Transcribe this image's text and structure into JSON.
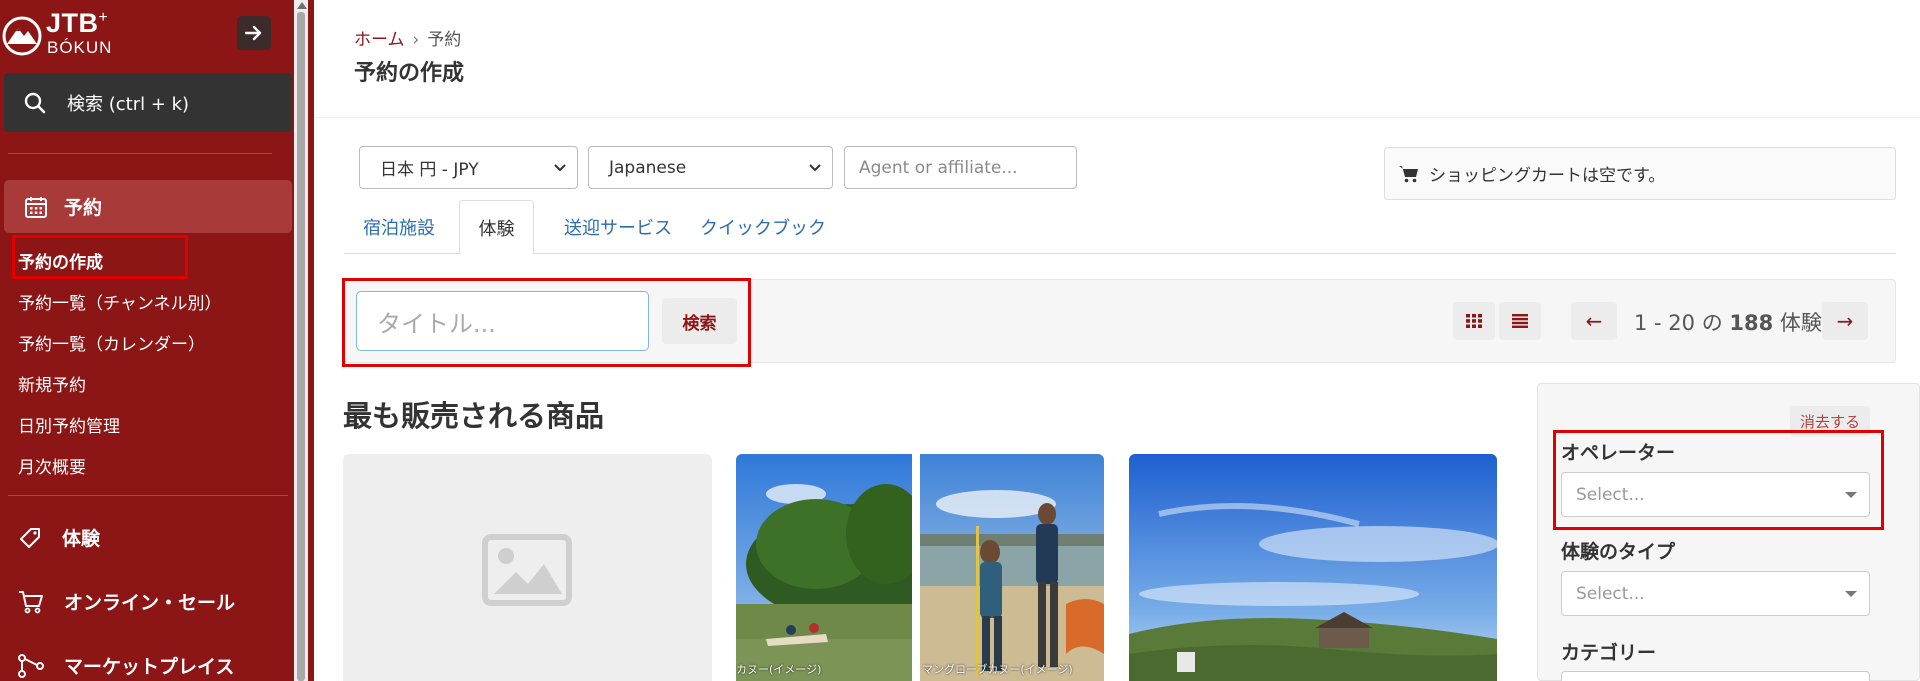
{
  "brand": {
    "name": "JTB",
    "plus": "+",
    "sub": "BÓKUN"
  },
  "sidebar": {
    "search_label": "検索 (ctrl + k)",
    "active_section": "予約",
    "sub_items": [
      {
        "label": "予約の作成"
      },
      {
        "label": "予約一覧（チャンネル別）"
      },
      {
        "label": "予約一覧（カレンダー）"
      },
      {
        "label": "新規予約"
      },
      {
        "label": "日別予約管理"
      },
      {
        "label": "月次概要"
      }
    ],
    "nav_items": [
      {
        "label": "体験",
        "icon": "tag-icon"
      },
      {
        "label": "オンライン・セール",
        "icon": "cart-icon"
      },
      {
        "label": "マーケットプレイス",
        "icon": "network-icon"
      }
    ]
  },
  "breadcrumb": {
    "home": "ホーム",
    "separator": "›",
    "current": "予約"
  },
  "page_title": "予約の作成",
  "filters_top": {
    "currency": "日本 円 - JPY",
    "language": "Japanese",
    "agent_placeholder": "Agent or affiliate..."
  },
  "cart": {
    "label": "ショッピングカートは空です。"
  },
  "tabs": [
    {
      "label": "宿泊施設"
    },
    {
      "label": "体験"
    },
    {
      "label": "送迎サービス"
    },
    {
      "label": "クイックブック"
    }
  ],
  "search": {
    "placeholder": "タイトル...",
    "button": "検索"
  },
  "pager": {
    "prev": "←",
    "next": "→",
    "range": "1 - 20",
    "of": "の",
    "total": "188",
    "unit": "体験"
  },
  "section_title": "最も販売される商品",
  "photo_captions": {
    "left": "カヌー(イメージ)",
    "right": "マングローブカヌー(イメージ)"
  },
  "filter_panel": {
    "clear": "消去する",
    "operator_label": "オペレーター",
    "operator_placeholder": "Select...",
    "type_label": "体験のタイプ",
    "type_placeholder": "Select...",
    "category_label": "カテゴリー"
  },
  "colors": {
    "brand": "#8c1515",
    "link": "#2b6cb0",
    "highlight": "#e00000"
  }
}
